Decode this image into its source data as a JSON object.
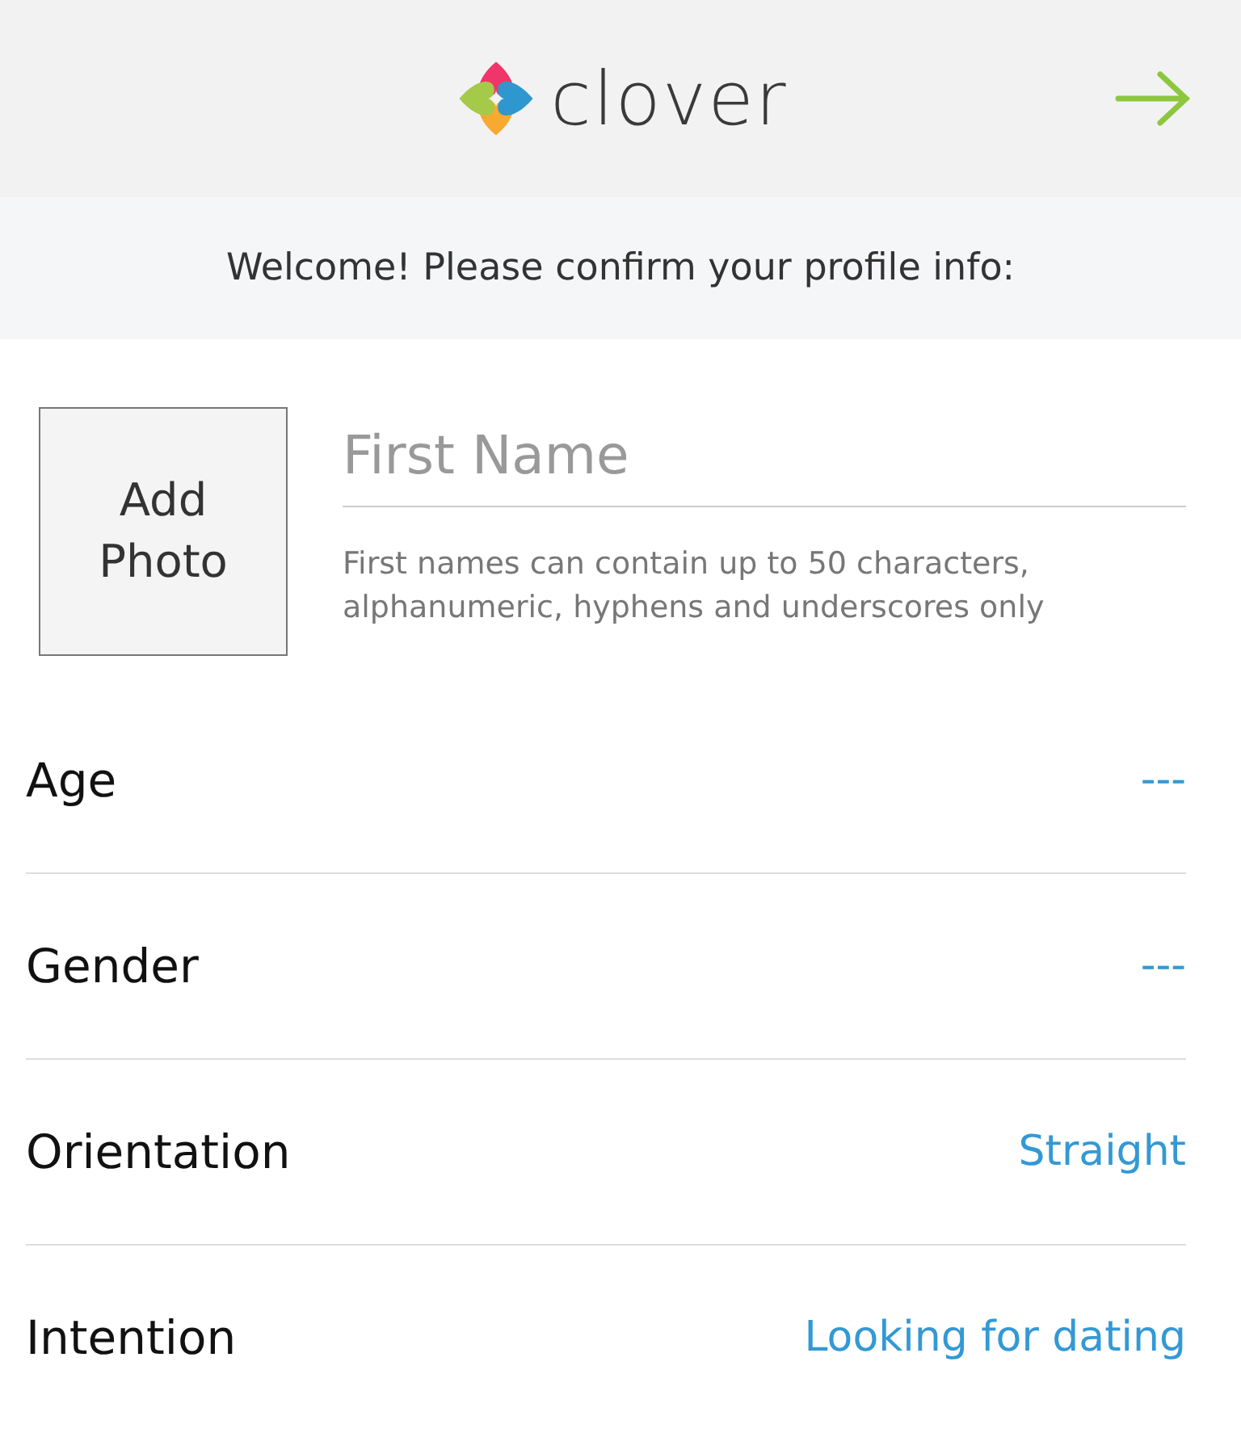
{
  "header": {
    "logo_text": "clover"
  },
  "welcome": "Welcome! Please confirm your profile info:",
  "photo_button": "Add Photo",
  "first_name": {
    "placeholder": "First Name",
    "hint": "First names can contain up to 50 characters, alphanumeric, hyphens and underscores only"
  },
  "fields": [
    {
      "label": "Age",
      "value": "---"
    },
    {
      "label": "Gender",
      "value": "---"
    },
    {
      "label": "Orientation",
      "value": "Straight"
    },
    {
      "label": "Intention",
      "value": "Looking for dating"
    }
  ]
}
